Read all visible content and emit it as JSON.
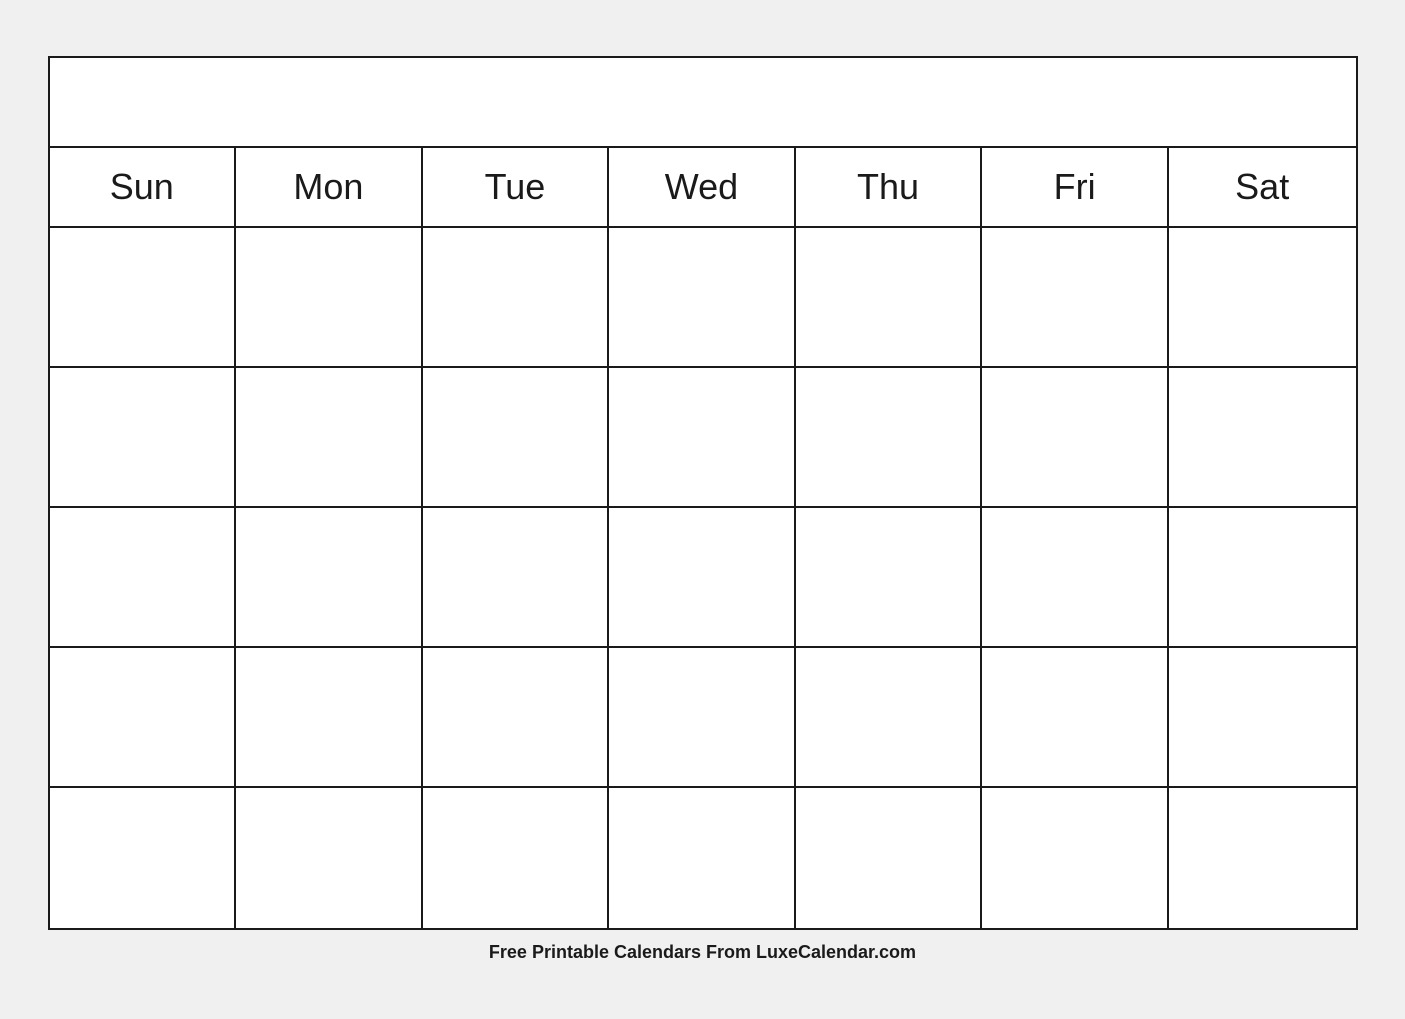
{
  "calendar": {
    "title": "",
    "days": [
      "Sun",
      "Mon",
      "Tue",
      "Wed",
      "Thu",
      "Fri",
      "Sat"
    ],
    "rows": 5,
    "cells_per_row": 7
  },
  "footer": {
    "text": "Free Printable Calendars From LuxeCalendar.com"
  }
}
